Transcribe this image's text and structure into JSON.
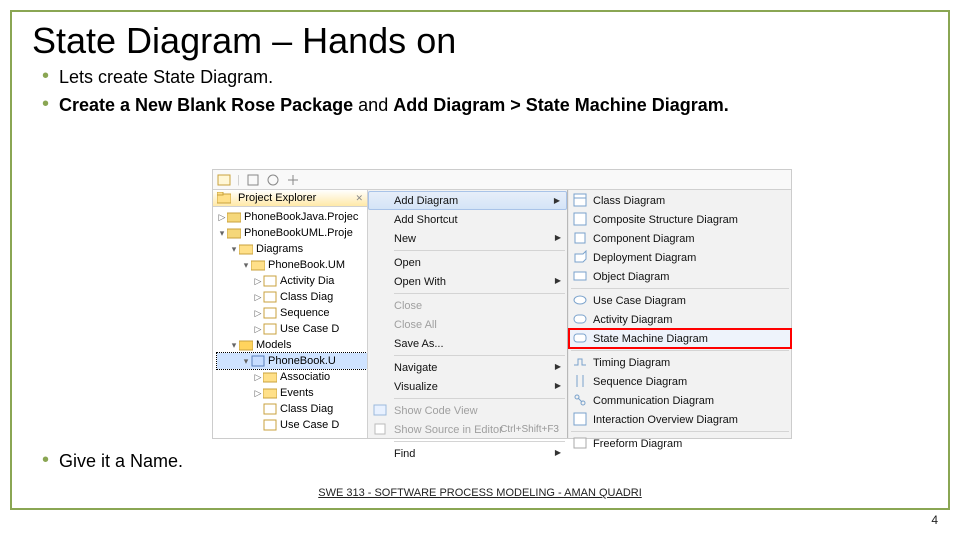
{
  "title": "State Diagram – Hands on",
  "bullets": {
    "b1": "Lets create State Diagram.",
    "b2a": "Create a New Blank Rose Package",
    "b2b": " and ",
    "b2c": "Add Diagram > State Machine Diagram.",
    "b3": "Give it a Name."
  },
  "explorer": {
    "tabLabel": "Project Explorer",
    "tabClose": "✕",
    "nodes": {
      "n0": "PhoneBookJava.Projec",
      "n1": "PhoneBookUML.Proje",
      "n2": "Diagrams",
      "n3": "PhoneBook.UM",
      "n4": "Activity Dia",
      "n5": "Class Diag",
      "n6": "Sequence",
      "n7": "Use Case D",
      "n8": "Models",
      "n9": "PhoneBook.U",
      "n10": "Associatio",
      "n11": "Events",
      "n12": "Class Diag",
      "n13": "Use Case D"
    }
  },
  "context": {
    "addDiagram": "Add Diagram",
    "addShortcut": "Add Shortcut",
    "new": "New",
    "open": "Open",
    "openWith": "Open With",
    "close": "Close",
    "closeAll": "Close All",
    "saveAs": "Save As...",
    "navigate": "Navigate",
    "visualize": "Visualize",
    "showCode": "Show Code View",
    "showSource": "Show Source in Editor",
    "showSourceKey": "Ctrl+Shift+F3",
    "find": "Find"
  },
  "submenu": {
    "s0": "Class Diagram",
    "s1": "Composite Structure Diagram",
    "s2": "Component Diagram",
    "s3": "Deployment Diagram",
    "s4": "Object Diagram",
    "s5": "Use Case Diagram",
    "s6": "Activity Diagram",
    "s7": "State Machine Diagram",
    "s8": "Timing Diagram",
    "s9": "Sequence Diagram",
    "s10": "Communication Diagram",
    "s11": "Interaction Overview Diagram",
    "s12": "Freeform Diagram"
  },
  "footer": "SWE 313 - SOFTWARE PROCESS MODELING - AMAN QUADRI",
  "pagenum": "4"
}
